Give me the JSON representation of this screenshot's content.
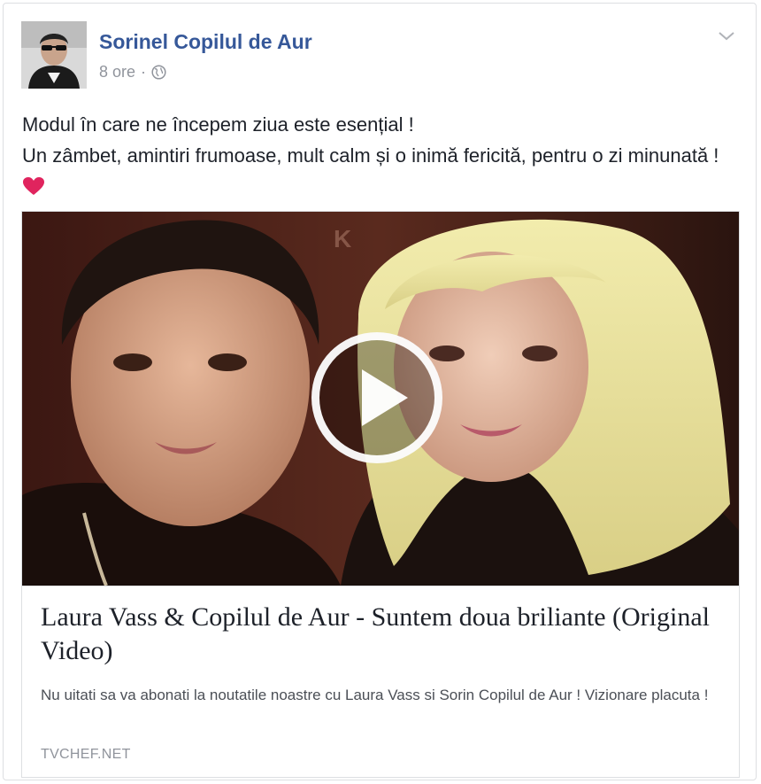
{
  "post": {
    "author_name": "Sorinel Copilul de Aur",
    "timestamp": "8 ore",
    "separator": "·",
    "privacy_icon": "globe-icon",
    "menu_icon": "chevron-down-icon",
    "text_lines": [
      "Modul în care ne începem ziua este esențial !",
      "Un zâmbet, amintiri frumoase, mult calm și o inimă fericită, pentru o zi minunată !"
    ],
    "emoji": "heart-icon"
  },
  "attachment": {
    "play_icon": "play-icon",
    "title": "Laura Vass & Copilul de Aur - Suntem doua briliante (Original Video)",
    "description": "Nu uitati sa va abonati la noutatile noastre cu Laura Vass si Sorin Copilul de Aur ! Vizionare placuta !",
    "domain": "TVCHEF.NET"
  },
  "colors": {
    "author_link": "#365899",
    "meta_gray": "#90949c",
    "heart": "#e0245e",
    "border": "#dddfe2"
  }
}
